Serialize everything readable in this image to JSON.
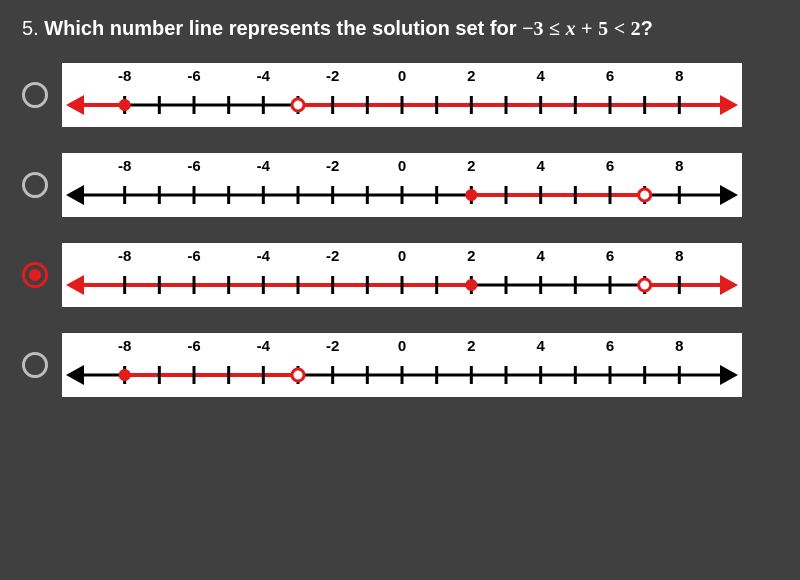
{
  "question": {
    "number": "5.",
    "prefix": "Which number line represents the solution set for ",
    "inequality_parts": [
      "−3",
      "≤",
      "x",
      "+",
      "5",
      "<",
      "2"
    ],
    "suffix": "?"
  },
  "numberline": {
    "min": -9,
    "max": 9,
    "tick_every": 1,
    "label_every": 2,
    "labels": [
      -8,
      -6,
      -4,
      -2,
      0,
      2,
      4,
      6,
      8
    ]
  },
  "options": [
    {
      "id": "opt-a",
      "selected": false,
      "red_ranges": [
        [
          -9,
          -8
        ],
        [
          -3,
          9
        ]
      ],
      "red_left_arrow": true,
      "red_right_arrow": true,
      "closed_points": [
        -8
      ],
      "open_points": [
        -3
      ]
    },
    {
      "id": "opt-b",
      "selected": false,
      "red_ranges": [
        [
          2,
          7
        ]
      ],
      "red_left_arrow": false,
      "red_right_arrow": false,
      "closed_points": [
        2
      ],
      "open_points": [
        7
      ]
    },
    {
      "id": "opt-c",
      "selected": true,
      "red_ranges": [
        [
          -9,
          2
        ],
        [
          7,
          9
        ]
      ],
      "red_left_arrow": true,
      "red_right_arrow": true,
      "closed_points": [
        2
      ],
      "open_points": [
        7
      ]
    },
    {
      "id": "opt-d",
      "selected": false,
      "red_ranges": [
        [
          -8,
          -3
        ]
      ],
      "red_left_arrow": false,
      "red_right_arrow": false,
      "closed_points": [
        -8
      ],
      "open_points": [
        -3
      ]
    }
  ],
  "colors": {
    "red": "#e21c1c",
    "black": "#000"
  }
}
